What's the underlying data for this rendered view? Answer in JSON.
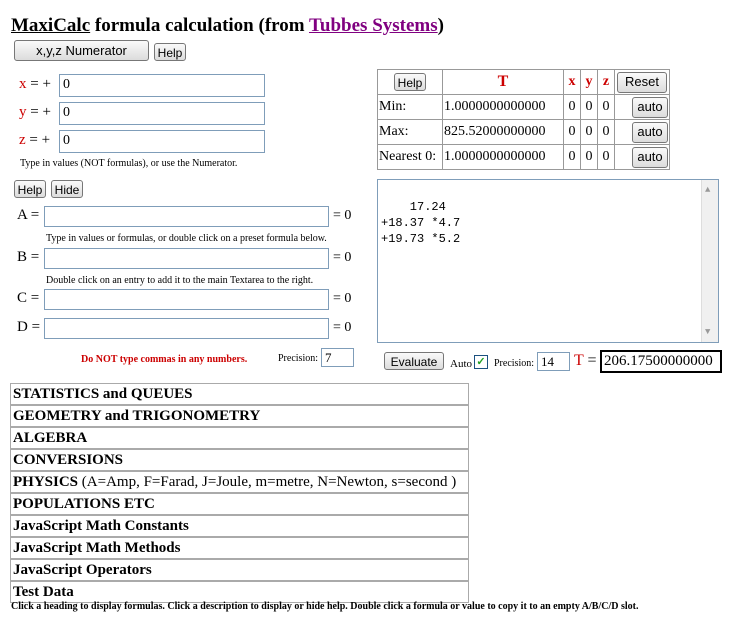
{
  "header": {
    "app_name": "MaxiCalc",
    "title_mid": " formula calculation (from ",
    "link": "Tubbes Systems",
    "title_end": ")"
  },
  "xyz": {
    "numerator_label": "x,y,z Numerator",
    "help_label": "Help",
    "rows": [
      {
        "var": "x",
        "eq": " = ",
        "sign": "+",
        "value": "0"
      },
      {
        "var": "y",
        "eq": " = ",
        "sign": "+",
        "value": "0"
      },
      {
        "var": "z",
        "eq": " = ",
        "sign": "+",
        "value": "0"
      }
    ],
    "note": "Type in values (NOT formulas), or use the Numerator."
  },
  "range_table": {
    "help_label": "Help",
    "t_header": "T",
    "x_header": "x",
    "y_header": "y",
    "z_header": "z",
    "reset_label": "Reset",
    "rows": [
      {
        "label": "Min:",
        "value": "1.0000000000000",
        "x": "0",
        "y": "0",
        "z": "0",
        "btn": "auto"
      },
      {
        "label": "Max:",
        "value": "825.52000000000",
        "x": "0",
        "y": "0",
        "z": "0",
        "btn": "auto"
      },
      {
        "label": "Nearest 0:",
        "value": "1.0000000000000",
        "x": "0",
        "y": "0",
        "z": "0",
        "btn": "auto"
      }
    ]
  },
  "main_text": "  17.24\n+18.37 *4.7\n+19.73 *5.2",
  "abcd": {
    "help_label": "Help",
    "hide_label": "Hide",
    "rows": [
      {
        "var": "A",
        "eq": " = ",
        "value": "",
        "result": "= 0"
      },
      {
        "var": "B",
        "eq": " = ",
        "value": "",
        "result": "= 0"
      },
      {
        "var": "C",
        "eq": " = ",
        "value": "",
        "result": "= 0"
      },
      {
        "var": "D",
        "eq": " = ",
        "value": "",
        "result": "= 0"
      }
    ],
    "note1": "Type in values or formulas, or double click on a preset formula below.",
    "note2": "Double click on an entry to add it to the main Textarea to the right.",
    "warning": "Do NOT type commas in any numbers.",
    "precision_label": "Precision:",
    "precision_value": "7"
  },
  "evaluate": {
    "button_label": "Evaluate",
    "auto_label": "Auto",
    "precision_label": "Precision:",
    "precision_value": "14",
    "t_label": "T",
    "t_eq": " = ",
    "result": "206.17500000000"
  },
  "categories": [
    {
      "label": "STATISTICS and QUEUES",
      "extra": ""
    },
    {
      "label": "GEOMETRY and TRIGONOMETRY",
      "extra": ""
    },
    {
      "label": "ALGEBRA",
      "extra": ""
    },
    {
      "label": "CONVERSIONS",
      "extra": ""
    },
    {
      "label": "PHYSICS",
      "extra": " (A=Amp, F=Farad, J=Joule, m=metre, N=Newton, s=second )"
    },
    {
      "label": "POPULATIONS ETC",
      "extra": ""
    },
    {
      "label": "JavaScript Math Constants",
      "extra": ""
    },
    {
      "label": "JavaScript Math Methods",
      "extra": ""
    },
    {
      "label": "JavaScript Operators",
      "extra": ""
    },
    {
      "label": "Test Data",
      "extra": ""
    }
  ],
  "footer": "Click a heading to display formulas. Click a description to display or hide help. Double click a formula or value to copy it to an empty A/B/C/D slot.",
  "colors": {
    "accent_red": "#cc0000",
    "link_purple": "#800080"
  }
}
